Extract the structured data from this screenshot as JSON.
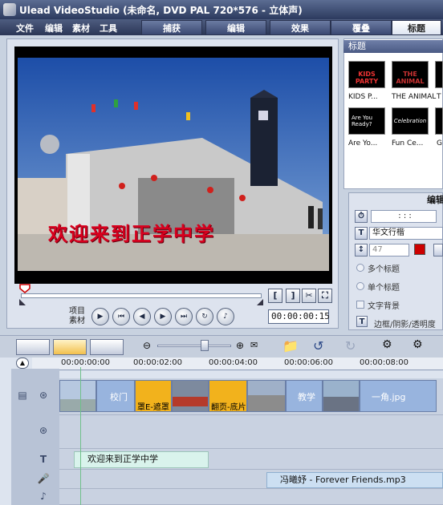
{
  "window": {
    "title": "Ulead VideoStudio (未命名, DVD PAL 720*576 - 立体声)"
  },
  "menu": {
    "items": [
      "文件",
      "编辑",
      "素材",
      "工具"
    ]
  },
  "steps": {
    "tabs": [
      "捕获",
      "编辑",
      "效果",
      "覆叠",
      "标题"
    ],
    "active": "标题"
  },
  "preview": {
    "caption": "欢迎来到正学中学",
    "mode_labels": [
      "项目",
      "素材"
    ],
    "timecode": "00:00:00:15"
  },
  "library": {
    "header": "标题",
    "thumbnails": [
      {
        "label": "KIDS P...",
        "art": "KIDS PARTY"
      },
      {
        "label": "THE ANIMAL",
        "art": "THE ANIMAL"
      },
      {
        "label": "T",
        "art": ""
      },
      {
        "label": "Are Yo...",
        "art": "Are You Ready?"
      },
      {
        "label": "Fun Ce...",
        "art": "Celebration"
      },
      {
        "label": "G",
        "art": ""
      }
    ]
  },
  "options": {
    "title": "编辑",
    "font": "华文行楷",
    "font_size": "47",
    "multi_title": "多个标题",
    "single_title": "单个标题",
    "text_background": "文字背景",
    "border_shadow": "边框/阴影/透明度",
    "color": "#cc0000"
  },
  "timeline": {
    "ruler_labels": [
      "00:00:00:00",
      "00:00:02:00",
      "00:00:04:00",
      "00:00:06:00",
      "00:00:08:00"
    ],
    "video_clips": [
      "校门",
      "罩E-遮罩",
      "翻页-底片",
      "教学",
      "一角.jpg"
    ],
    "title_clip": "欢迎来到正学中学",
    "music_clip": "冯曦妤 - Forever Friends.mp3",
    "add_track_label": "+/-"
  }
}
